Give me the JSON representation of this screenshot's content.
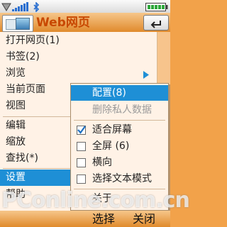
{
  "status_bar": {
    "icons": [
      "network-icon",
      "signal-strength-icon",
      "bluetooth-icon",
      "battery-icon"
    ]
  },
  "title_bar": {
    "title": "Web网页",
    "app_icon": "browser-app-icon",
    "back_icon": "back-arrow-icon"
  },
  "main_menu": {
    "items": [
      {
        "label": "打开网页(1)"
      },
      {
        "label": "书签(2)"
      },
      {
        "label": "浏览",
        "has_submenu": true
      },
      {
        "label": "当前页面"
      },
      {
        "label": "视图"
      },
      {
        "label": "编辑"
      },
      {
        "label": "缩放"
      },
      {
        "label": "查找(*)"
      },
      {
        "label": "设置",
        "selected": true
      },
      {
        "label": "帮助"
      }
    ]
  },
  "submenu": {
    "items": [
      {
        "label": "配置(8)",
        "selected": true
      },
      {
        "label": "删除私人数据",
        "disabled": true
      },
      {
        "label": "适合屏幕",
        "checked": true
      },
      {
        "label": "全屏 (6)",
        "checked": false
      },
      {
        "label": "横向",
        "checked": false
      },
      {
        "label": "选择文本模式",
        "checked": false
      },
      {
        "label": "关于"
      }
    ]
  },
  "softkeys": {
    "left": "选择",
    "right": "关闭"
  },
  "watermark": "PConline.com.cn",
  "colors": {
    "accent_orange": "#e08a2c",
    "selection_blue": "#1e8fd6",
    "menu_background": "#fff2e6"
  }
}
